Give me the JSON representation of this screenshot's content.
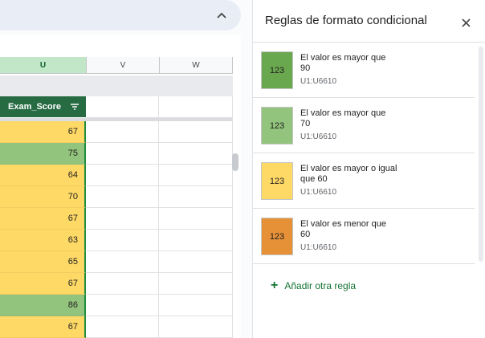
{
  "columns": {
    "u": "U",
    "v": "V",
    "w": "W"
  },
  "sheet": {
    "header": "Exam_Score",
    "rows": [
      {
        "value": "67",
        "fill": "#ffd966"
      },
      {
        "value": "75",
        "fill": "#93c47d"
      },
      {
        "value": "64",
        "fill": "#ffd966"
      },
      {
        "value": "70",
        "fill": "#ffd966"
      },
      {
        "value": "67",
        "fill": "#ffd966"
      },
      {
        "value": "63",
        "fill": "#ffd966"
      },
      {
        "value": "65",
        "fill": "#ffd966"
      },
      {
        "value": "67",
        "fill": "#ffd966"
      },
      {
        "value": "86",
        "fill": "#93c47d"
      },
      {
        "value": "67",
        "fill": "#ffd966"
      }
    ]
  },
  "panel": {
    "title": "Reglas de formato condicional",
    "add_rule": "Añadir otra regla",
    "rules": [
      {
        "swatch": "123",
        "line1": "El valor es mayor que",
        "line2": "90",
        "range": "U1:U6610",
        "color": "#6aa84f"
      },
      {
        "swatch": "123",
        "line1": "El valor es mayor que",
        "line2": "70",
        "range": "U1:U6610",
        "color": "#93c47d"
      },
      {
        "swatch": "123",
        "line1": "El valor es mayor o igual",
        "line2": "que 60",
        "range": "U1:U6610",
        "color": "#ffd966"
      },
      {
        "swatch": "123",
        "line1": "El valor es menor que",
        "line2": "60",
        "range": "U1:U6610",
        "color": "#e69138"
      }
    ]
  },
  "icons": {
    "collapse": "chevron-up-icon",
    "filter": "filter-icon",
    "close": "close-icon",
    "add": "plus-icon"
  }
}
